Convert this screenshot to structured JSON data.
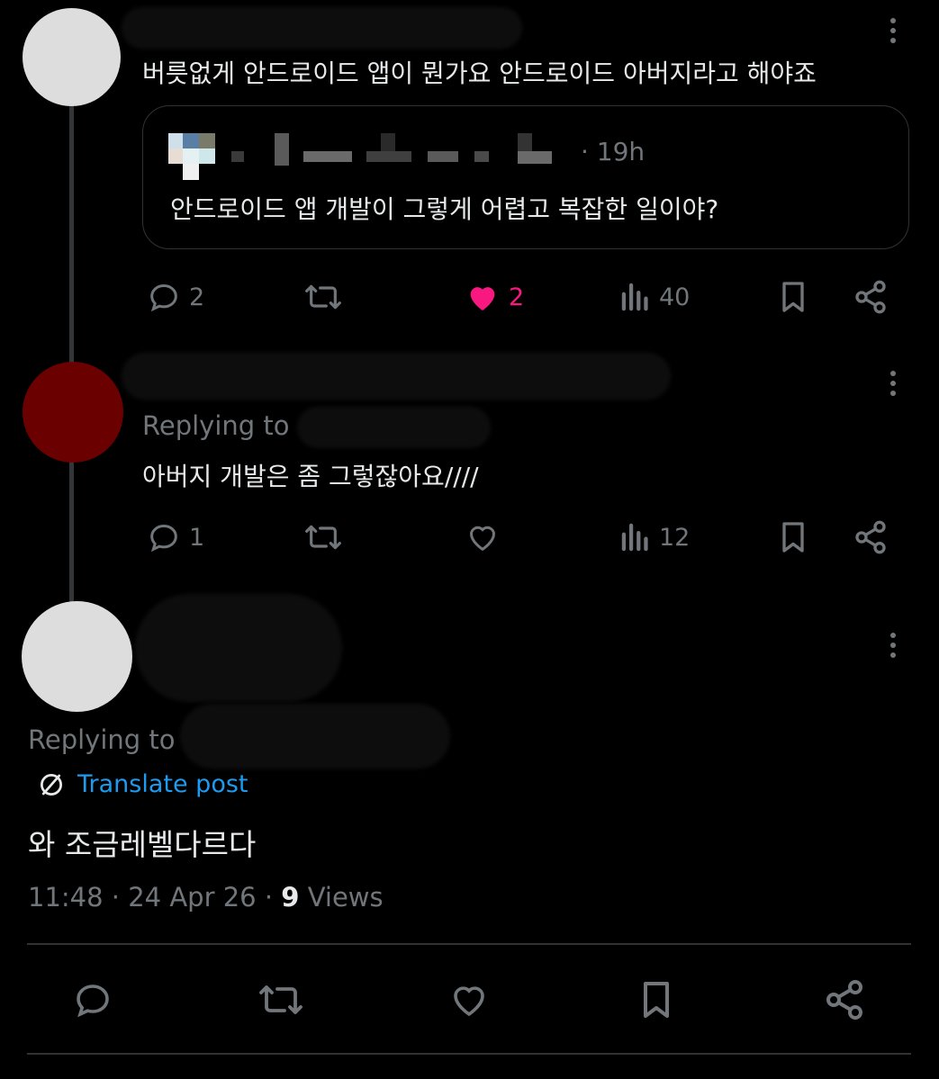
{
  "post1": {
    "text": "버릇없게 안드로이드 앱이 뭔가요 안드로이드 아버지라고 해야죠",
    "quote": {
      "time": "· 19h",
      "text": "안드로이드 앱 개발이 그렇게 어렵고 복잡한 일이야?"
    },
    "actions": {
      "replies": "2",
      "likes": "2",
      "views": "40"
    },
    "avatar_color": "#dddddd"
  },
  "post2": {
    "replying_label": "Replying to",
    "text": "아버지 개발은 좀 그렇잖아요////",
    "actions": {
      "replies": "1",
      "views": "12"
    },
    "avatar_color": "#6b0000"
  },
  "post3": {
    "replying_label": "Replying to",
    "translate": "Translate post",
    "text": "와 조금레벨다르다",
    "time": "11:48 · 24 Apr 26 · ",
    "views_count": "9",
    "views_label": " Views",
    "avatar_color": "#dddddd"
  },
  "colors": {
    "background": "#000000",
    "text": "#e7e9ea",
    "muted": "#71767b",
    "like": "#f91880",
    "link": "#1d9bf0"
  },
  "icons": [
    "reply-icon",
    "retweet-icon",
    "heart-icon",
    "views-icon",
    "bookmark-icon",
    "share-icon",
    "more-icon",
    "translate-icon"
  ]
}
